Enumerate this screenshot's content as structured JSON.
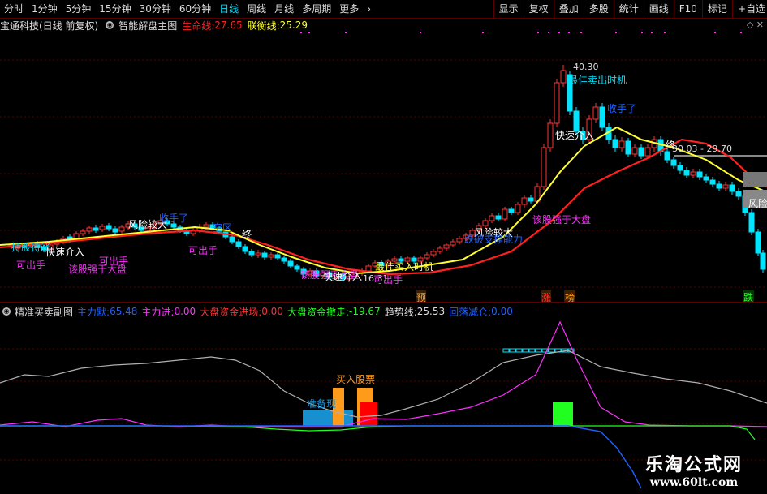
{
  "toolbar": {
    "periods": [
      "分时",
      "1分钟",
      "5分钟",
      "15分钟",
      "30分钟",
      "60分钟",
      "日线",
      "周线",
      "月线",
      "多周期",
      "更多"
    ],
    "active_period": "日线",
    "more_arrow": "›",
    "right_buttons": [
      "显示",
      "复权",
      "叠加",
      "多股",
      "统计",
      "画线",
      "F10",
      "标记",
      "+自选"
    ]
  },
  "main_header": {
    "title": "宝通科技(日线 前复权)",
    "indicator_name": "智能解盘主图",
    "life_line_label": "生命线:",
    "life_line_value": "27.65",
    "link_line_label": "联衡线:",
    "link_line_value": "25.29"
  },
  "sub_header": {
    "title": "精准买卖副图",
    "main_force_label": "主力默:",
    "main_force_value": "65.48",
    "main_in_label": "主力进:",
    "main_in_value": "0.00",
    "big_in_label": "大盘资金进场:",
    "big_in_value": "0.00",
    "big_out_label": "大盘资金撤走:",
    "big_out_value": "-19.67",
    "trend_label": "趋势线:",
    "trend_value": "25.53",
    "reduce_label": "回落减仓:",
    "reduce_value": "0.00"
  },
  "price_labels": {
    "high": "40.30",
    "low": "16.31",
    "current": "30.03 - 29.70"
  },
  "annotations": {
    "sell1": "可出手",
    "sell2": "可出手",
    "sell3": "可出手",
    "sell4": "可出手",
    "strong1": "该股强于大盘",
    "strong2": "该股强于大盘",
    "strong3": "该股强于大盘",
    "risk1": "风险较大",
    "risk2": "风险较大",
    "risk3": "风险",
    "fast_in1": "快速介入",
    "fast_in2": "快速介入",
    "fast_in3": "快速介入",
    "best_sell": "最佳卖出时机",
    "best_buy": "最佳买入时机",
    "take_profit1": "收手了",
    "take_profit2": "收手了",
    "hold_weak": "持股待涨",
    "drop_power": "跌破支撑能力",
    "zone": "空区",
    "end1": "终",
    "end2": "终",
    "markers": [
      "预",
      "涨",
      "榜",
      "跌"
    ],
    "prepare_buy": "准备现",
    "buy_stock": "买入股票"
  },
  "colors": {
    "bg": "#000000",
    "up": "#ff3232",
    "down": "#00e5ff",
    "life_line": "#ff2020",
    "link_line": "#ffff30",
    "magenta": "#ff30ff",
    "orange": "#ff9a1a",
    "green": "#20ff20",
    "blue": "#2060ff",
    "gray_line": "#b0b0b0"
  },
  "watermark": {
    "line1": "乐淘公式网",
    "line2": "www.60lt.com"
  }
}
